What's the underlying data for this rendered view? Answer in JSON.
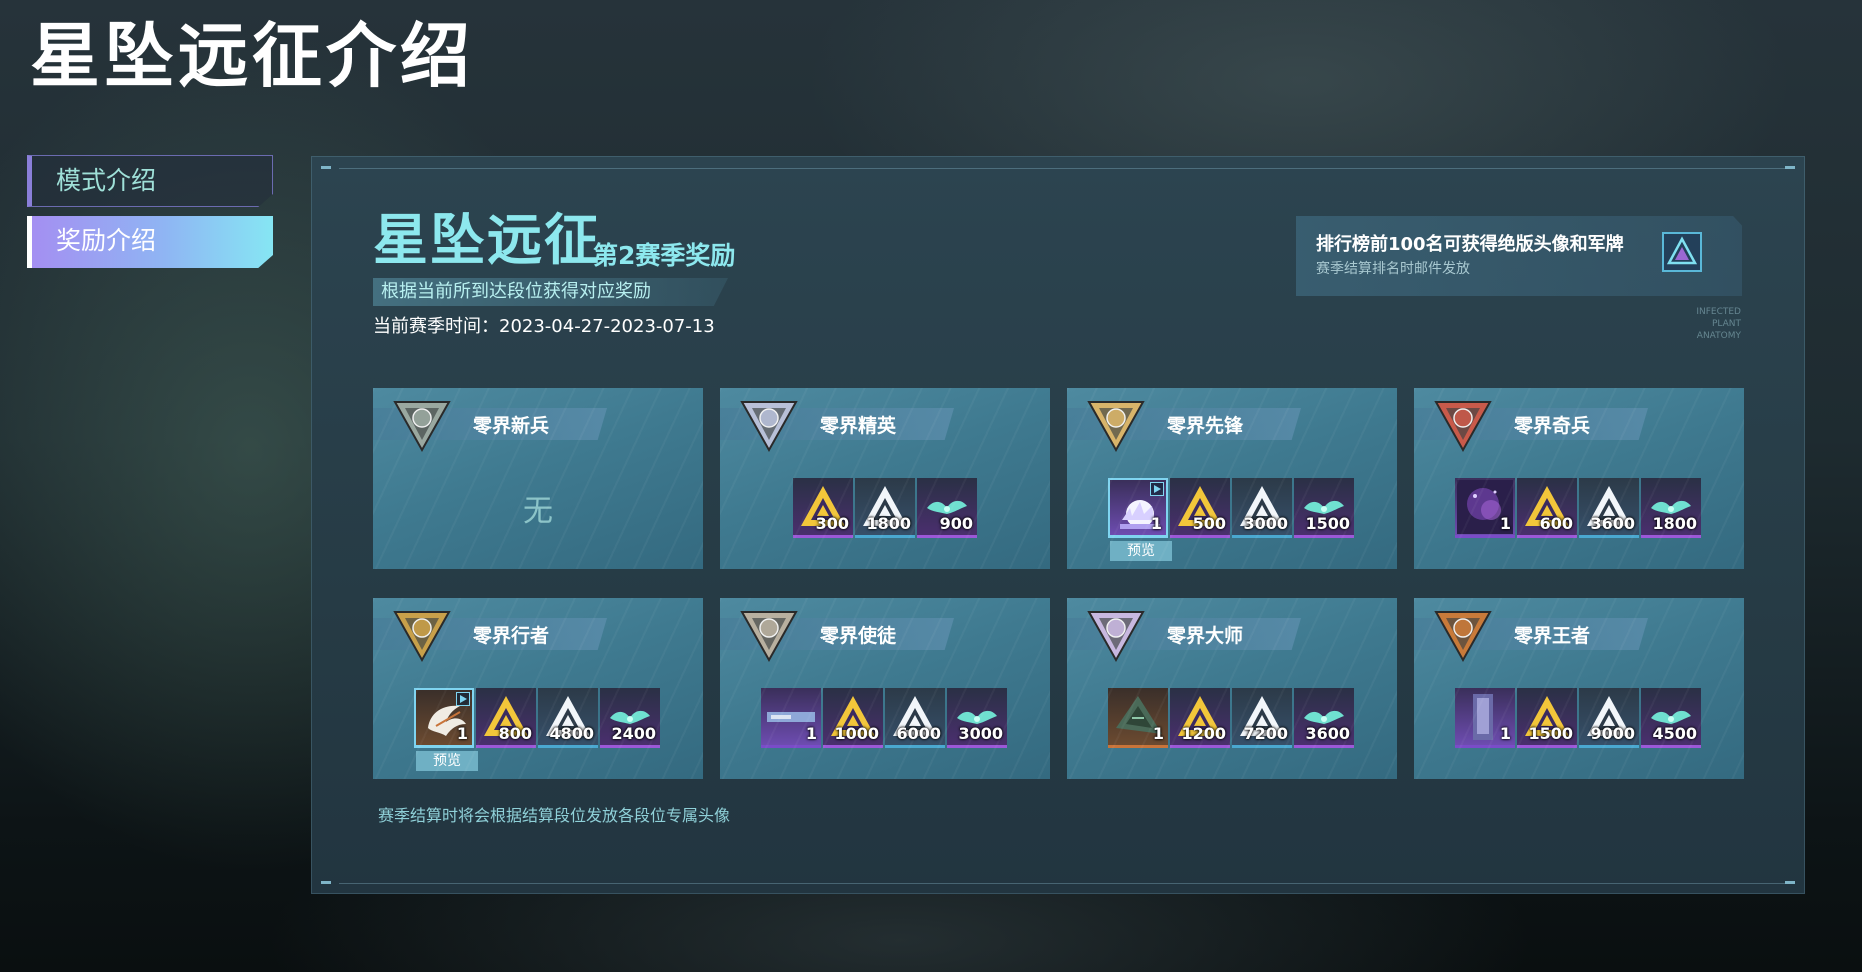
{
  "page_title": "星坠远征介绍",
  "nav": {
    "items": [
      {
        "label": "模式介绍",
        "active": false
      },
      {
        "label": "奖励介绍",
        "active": true
      }
    ]
  },
  "season": {
    "title": "星坠远征",
    "subtitle": "第2赛季奖励",
    "hint": "根据当前所到达段位获得对应奖励",
    "time": "当前赛季时间：2023-04-27-2023-07-13"
  },
  "rank_banner": {
    "title": "排行榜前100名可获得绝版头像和军牌",
    "subtitle": "赛季结算排名时邮件发放",
    "icon": "triangle-medal-icon"
  },
  "deco_text": [
    "INFECTED",
    "PLANT",
    "ANATOMY"
  ],
  "tiers": [
    {
      "name": "零界新兵",
      "badge_color": "#9aa8a0",
      "none_text": "无",
      "rewards": []
    },
    {
      "name": "零界精英",
      "badge_color": "#b8c0d8",
      "rewards": [
        {
          "icon": "gold-triangle-icon",
          "count": "300",
          "style": "purple"
        },
        {
          "icon": "white-triangle-icon",
          "count": "1800",
          "style": "cyan"
        },
        {
          "icon": "cyan-wing-icon",
          "count": "900",
          "style": "purple"
        }
      ]
    },
    {
      "name": "零界先锋",
      "badge_color": "#d8b46a",
      "rewards": [
        {
          "icon": "explosion-avatar-icon",
          "count": "1",
          "style": "special",
          "preview": "预览"
        },
        {
          "icon": "gold-triangle-icon",
          "count": "500",
          "style": "purple"
        },
        {
          "icon": "white-triangle-icon",
          "count": "3000",
          "style": "cyan"
        },
        {
          "icon": "cyan-wing-icon",
          "count": "1500",
          "style": "purple"
        }
      ]
    },
    {
      "name": "零界奇兵",
      "badge_color": "#c85a4a",
      "rewards": [
        {
          "icon": "nebula-card-icon",
          "count": "1",
          "style": "special"
        },
        {
          "icon": "gold-triangle-icon",
          "count": "600",
          "style": "purple"
        },
        {
          "icon": "white-triangle-icon",
          "count": "3600",
          "style": "cyan"
        },
        {
          "icon": "cyan-wing-icon",
          "count": "1800",
          "style": "purple"
        }
      ]
    },
    {
      "name": "零界行者",
      "badge_color": "#c8a04a",
      "rewards": [
        {
          "icon": "claw-avatar-icon",
          "count": "1",
          "style": "orange",
          "preview": "预览"
        },
        {
          "icon": "gold-triangle-icon",
          "count": "800",
          "style": "purple"
        },
        {
          "icon": "white-triangle-icon",
          "count": "4800",
          "style": "cyan"
        },
        {
          "icon": "cyan-wing-icon",
          "count": "2400",
          "style": "purple"
        }
      ]
    },
    {
      "name": "零界使徒",
      "badge_color": "#b8b0a0",
      "rewards": [
        {
          "icon": "nameplate-icon",
          "count": "1",
          "style": "special"
        },
        {
          "icon": "gold-triangle-icon",
          "count": "1000",
          "style": "purple"
        },
        {
          "icon": "white-triangle-icon",
          "count": "6000",
          "style": "cyan"
        },
        {
          "icon": "cyan-wing-icon",
          "count": "3000",
          "style": "purple"
        }
      ]
    },
    {
      "name": "零界大师",
      "badge_color": "#c8b8e0",
      "rewards": [
        {
          "icon": "green-triangle-icon",
          "count": "1",
          "style": "orange"
        },
        {
          "icon": "gold-triangle-icon",
          "count": "1200",
          "style": "purple"
        },
        {
          "icon": "white-triangle-icon",
          "count": "7200",
          "style": "cyan"
        },
        {
          "icon": "cyan-wing-icon",
          "count": "3600",
          "style": "purple"
        }
      ]
    },
    {
      "name": "零界王者",
      "badge_color": "#c87a3a",
      "rewards": [
        {
          "icon": "crystal-card-icon",
          "count": "1",
          "style": "special"
        },
        {
          "icon": "gold-triangle-icon",
          "count": "1500",
          "style": "purple"
        },
        {
          "icon": "white-triangle-icon",
          "count": "9000",
          "style": "cyan"
        },
        {
          "icon": "cyan-wing-icon",
          "count": "4500",
          "style": "purple"
        }
      ]
    }
  ],
  "footnote": "赛季结算时将会根据结算段位发放各段位专属头像"
}
